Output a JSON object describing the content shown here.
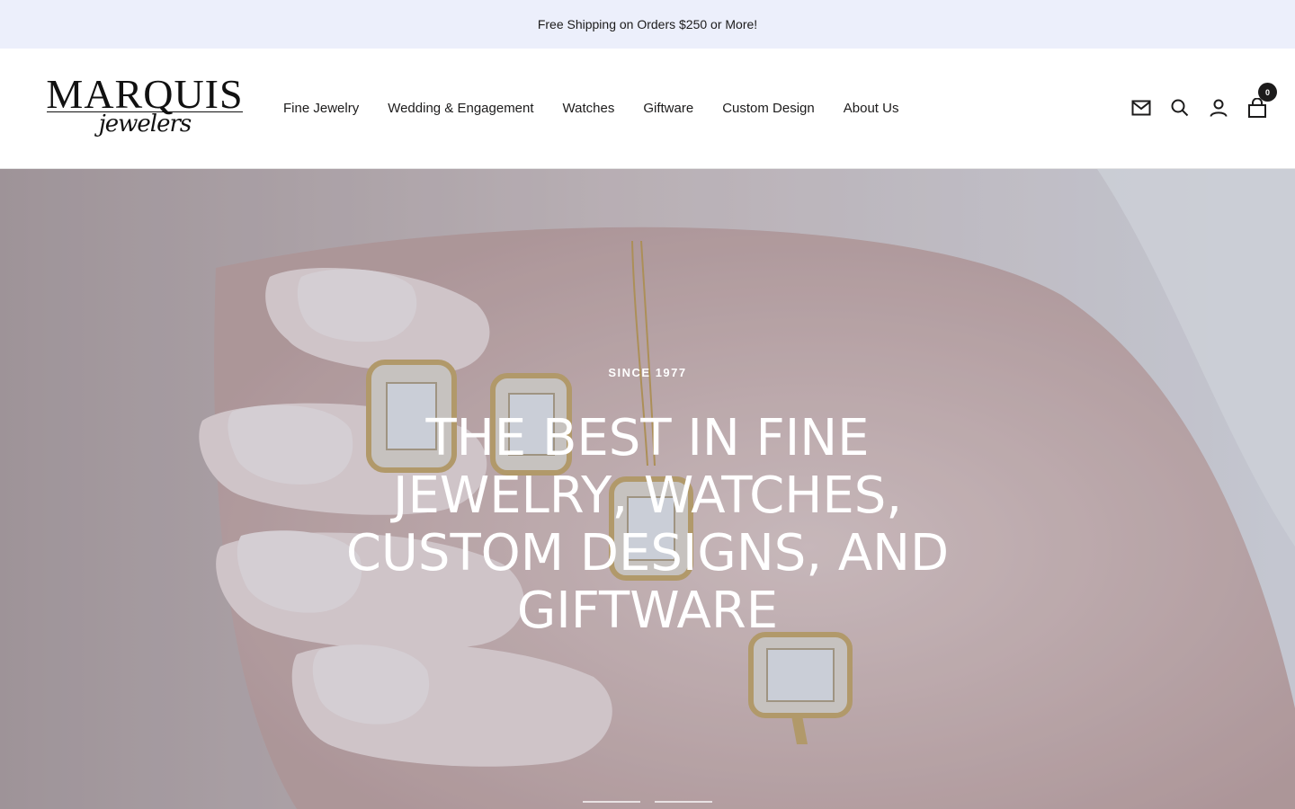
{
  "announcement": {
    "text": "Free Shipping on Orders $250 or More!"
  },
  "header": {
    "logo": {
      "main": "MARQUIS",
      "sub": "jewelers"
    },
    "nav": [
      {
        "label": "Fine Jewelry"
      },
      {
        "label": "Wedding & Engagement"
      },
      {
        "label": "Watches"
      },
      {
        "label": "Giftware"
      },
      {
        "label": "Custom Design"
      },
      {
        "label": "About Us"
      }
    ],
    "icons": [
      "newsletter-icon",
      "search-icon",
      "account-icon",
      "cart-icon"
    ],
    "cart_count": "0"
  },
  "hero": {
    "kicker": "SINCE 1977",
    "title": "THE BEST IN FINE JEWELRY, WATCHES, CUSTOM DESIGNS, AND GIFTWARE",
    "slides_total": 2
  },
  "colors": {
    "announcement_bg": "#eceffb",
    "text": "#1c1b1b",
    "hero_text": "#ffffff"
  }
}
